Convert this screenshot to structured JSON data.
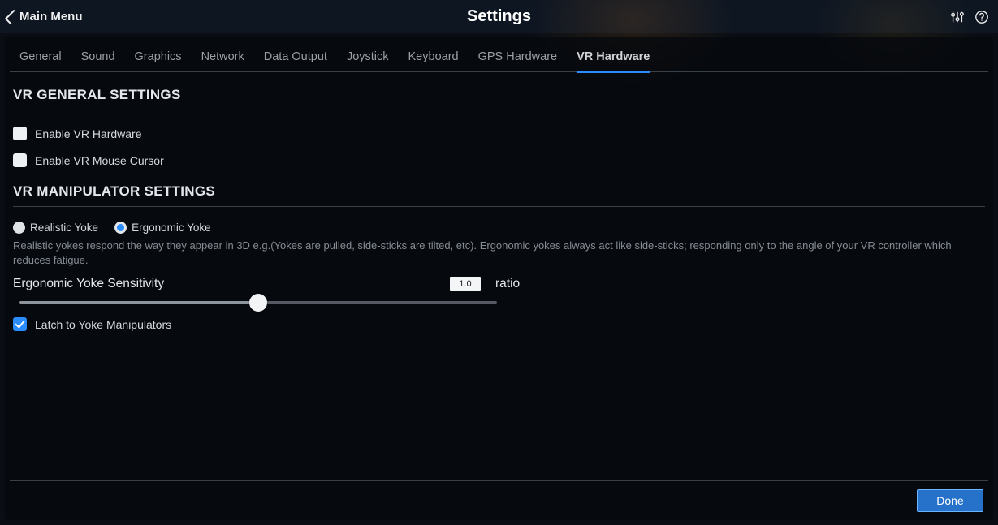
{
  "header": {
    "back_label": "Main Menu",
    "title": "Settings"
  },
  "tabs": [
    {
      "label": "General",
      "active": false
    },
    {
      "label": "Sound",
      "active": false
    },
    {
      "label": "Graphics",
      "active": false
    },
    {
      "label": "Network",
      "active": false
    },
    {
      "label": "Data Output",
      "active": false
    },
    {
      "label": "Joystick",
      "active": false
    },
    {
      "label": "Keyboard",
      "active": false
    },
    {
      "label": "GPS Hardware",
      "active": false
    },
    {
      "label": "VR Hardware",
      "active": true
    }
  ],
  "sections": {
    "general": {
      "title": "VR GENERAL SETTINGS",
      "enable_hardware": {
        "label": "Enable VR Hardware",
        "checked": false
      },
      "enable_mouse": {
        "label": "Enable VR Mouse Cursor",
        "checked": false
      }
    },
    "manipulator": {
      "title": "VR MANIPULATOR SETTINGS",
      "yoke_options": {
        "realistic": {
          "label": "Realistic Yoke",
          "selected": false
        },
        "ergonomic": {
          "label": "Ergonomic Yoke",
          "selected": true
        }
      },
      "hint": "Realistic yokes respond the way they appear in 3D e.g.(Yokes are pulled, side-sticks are tilted, etc). Ergonomic yokes always act like side-sticks; responding only to the angle of your VR controller which reduces fatigue.",
      "sensitivity": {
        "label": "Ergonomic Yoke Sensitivity",
        "value": "1.0",
        "unit": "ratio",
        "percent": 50
      },
      "latch": {
        "label": "Latch to Yoke Manipulators",
        "checked": true
      }
    }
  },
  "footer": {
    "done_label": "Done"
  }
}
